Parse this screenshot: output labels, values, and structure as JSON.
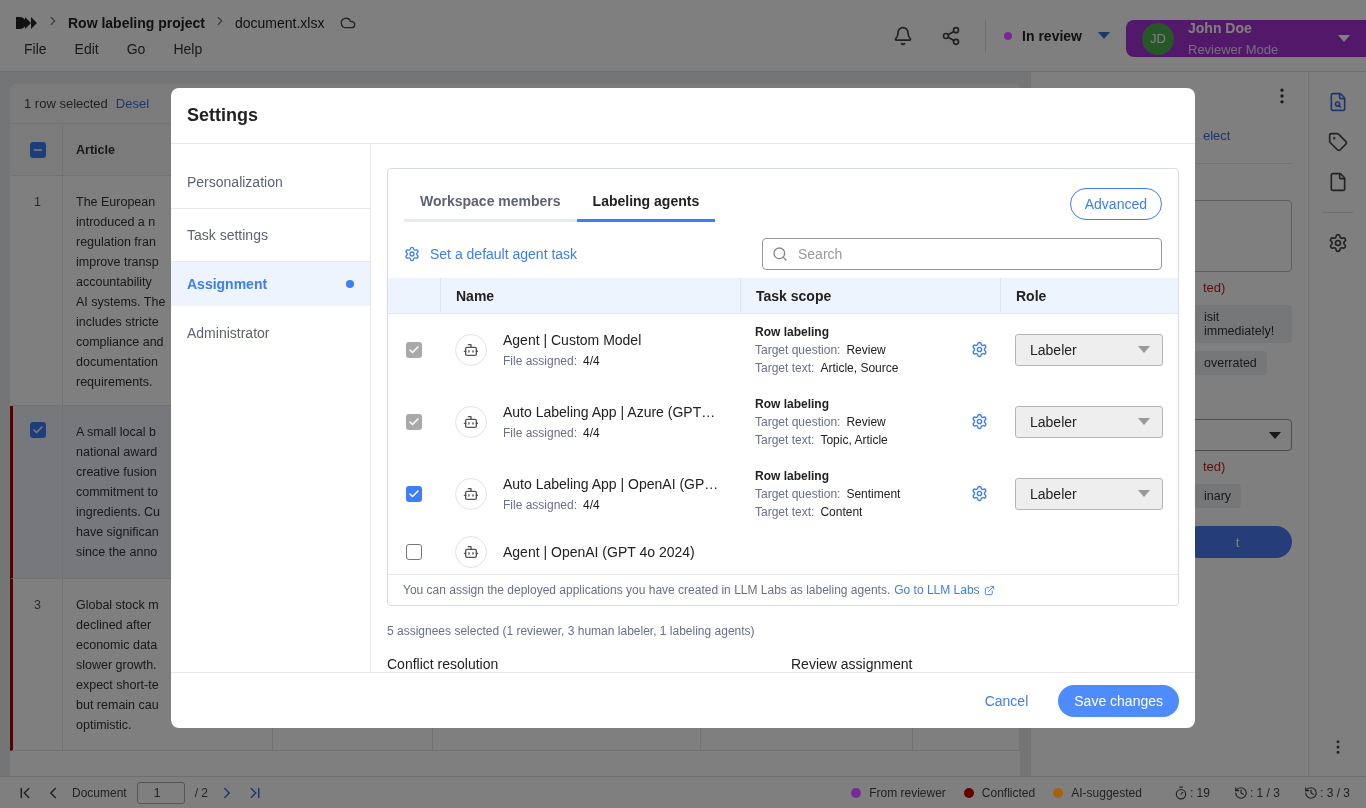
{
  "app": {
    "breadcrumb": [
      "Row labeling project",
      "document.xlsx"
    ],
    "menu": [
      "File",
      "Edit",
      "Go",
      "Help"
    ],
    "status": {
      "label": "In review",
      "color": "#7a2a96"
    },
    "user": {
      "initials": "JD",
      "name": "John Doe",
      "mode": "Reviewer Mode"
    }
  },
  "table": {
    "selection_text": "1 row selected",
    "deselect": "Desel",
    "header_indeterminate": true,
    "header": "Article",
    "rows": [
      {
        "number": "1",
        "selected": false,
        "conflicted": false,
        "lines": [
          "The European",
          "introduced a n",
          "regulation fran",
          "improve transp",
          "accountability",
          "AI systems. The",
          "includes stricte",
          "compliance and",
          "documentation",
          "requirements."
        ]
      },
      {
        "selected": true,
        "conflicted": true,
        "lines": [
          "A small local b",
          "national award",
          "creative fusion",
          "commitment to",
          "ingredients. Cu",
          "have significan",
          "since the anno"
        ]
      },
      {
        "number": "3",
        "selected": false,
        "conflicted": true,
        "lines": [
          "Global stock m",
          "declined after",
          "economic data",
          "slower growth.",
          "expect short-te",
          "but remain cau",
          "optimistic."
        ]
      }
    ]
  },
  "side_panel": {
    "link": "elect",
    "note_1": "ted)",
    "chips_1": [
      "isit immediately!",
      "overrated"
    ],
    "note_2": "ted)",
    "chips_2": [
      "inary"
    ],
    "button": "t"
  },
  "footer": {
    "label": "Document",
    "page": "1",
    "total": "/ 2",
    "legend": [
      {
        "label": "From reviewer",
        "color": "#7a2a96"
      },
      {
        "label": "Conflicted",
        "color": "#650000"
      },
      {
        "label": "AI-suggested",
        "color": "#a8620f"
      }
    ],
    "counters": [
      ": 19",
      ": 1 / 3",
      ": 3 / 3"
    ]
  },
  "dialog": {
    "title": "Settings",
    "nav": [
      {
        "label": "Personalization",
        "selected": false,
        "modified": false
      },
      {
        "label": "Task settings",
        "selected": false,
        "modified": false
      },
      {
        "label": "Assignment",
        "selected": true,
        "modified": true
      },
      {
        "label": "Administrator",
        "selected": false,
        "modified": false
      }
    ],
    "tabs": [
      {
        "label": "Workspace members",
        "selected": false
      },
      {
        "label": "Labeling agents",
        "selected": true
      }
    ],
    "advanced": "Advanced",
    "default_task": "Set a default agent task",
    "search": {
      "placeholder": "Search"
    },
    "columns": [
      "Name",
      "Task scope",
      "Role"
    ],
    "agents": [
      {
        "name": "Agent | Custom Model",
        "checked": true,
        "disabled": true,
        "files_label": "File assigned:",
        "files": "4/4",
        "scope": "Row labeling",
        "question_label": "Target question:",
        "question": "Review",
        "text_label": "Target text:",
        "text": "Article, Source",
        "role": "Labeler"
      },
      {
        "name": "Auto Labeling App | Azure (GPT…",
        "checked": true,
        "disabled": true,
        "files_label": "File assigned:",
        "files": "4/4",
        "scope": "Row labeling",
        "question_label": "Target question:",
        "question": "Review",
        "text_label": "Target text:",
        "text": "Topic, Article",
        "role": "Labeler"
      },
      {
        "name": "Auto Labeling App | OpenAI (GP…",
        "checked": true,
        "disabled": false,
        "files_label": "File assigned:",
        "files": "4/4",
        "scope": "Row labeling",
        "question_label": "Target question:",
        "question": "Sentiment",
        "text_label": "Target text:",
        "text": "Content",
        "role": "Labeler"
      },
      {
        "name": "Agent | OpenAI (GPT 4o 2024)",
        "checked": false
      }
    ],
    "note": "You can assign the deployed applications you have created in LLM Labs as labeling agents.",
    "note_link": "Go to LLM Labs",
    "summary": "5 assignees selected (1 reviewer, 3 human labeler, 1 labeling agents)",
    "sections": [
      "Conflict resolution",
      "Review assignment"
    ],
    "cancel": "Cancel",
    "save": "Save changes"
  }
}
